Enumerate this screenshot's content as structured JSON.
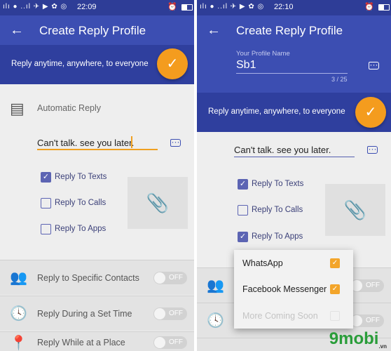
{
  "left": {
    "status": {
      "signal": "ılı ● ..ıl ✈ ▶ ✿ ◎",
      "time": "22:09"
    },
    "toolbar": {
      "title": "Create Reply Profile"
    },
    "banner": {
      "text": "Reply anytime, anywhere, to everyone"
    },
    "automatic_reply": {
      "label": "Automatic Reply"
    },
    "message": {
      "value": "Can't talk. see you later."
    },
    "checkboxes": [
      {
        "label": "Reply To Texts",
        "checked": true
      },
      {
        "label": "Reply To Calls",
        "checked": false
      },
      {
        "label": "Reply To Apps",
        "checked": false
      }
    ],
    "rows": [
      {
        "label": "Reply to Specific Contacts",
        "toggle": "OFF"
      },
      {
        "label": "Reply During a Set Time",
        "toggle": "OFF"
      },
      {
        "label": "Reply While at a Place",
        "toggle": "OFF"
      }
    ]
  },
  "right": {
    "status": {
      "signal": "ılı ● ..ıl ✈ ▶ ✿ ◎",
      "time": "22:10"
    },
    "toolbar": {
      "title": "Create Reply Profile",
      "profile_label": "Your Profile Name",
      "profile_value": "Sb1",
      "counter": "3 / 25"
    },
    "banner": {
      "text": "Reply anytime, anywhere, to everyone"
    },
    "message": {
      "value": "Can't talk. see you later."
    },
    "checkboxes": [
      {
        "label": "Reply To Texts",
        "checked": true
      },
      {
        "label": "Reply To Calls",
        "checked": false
      },
      {
        "label": "Reply To Apps",
        "checked": true
      }
    ],
    "rows": [
      {
        "toggle": "OFF"
      },
      {
        "toggle": "OFF"
      }
    ],
    "popup": [
      {
        "label": "WhatsApp",
        "checked": true
      },
      {
        "label": "Facebook Messenger",
        "checked": true
      },
      {
        "label": "More Coming Soon",
        "checked": false,
        "disabled": true
      }
    ]
  },
  "watermark": {
    "text": "9mobi",
    "sub": ".vn"
  },
  "colors": {
    "primary": "#3c4eb2",
    "banner": "#2f3f9e",
    "accent": "#f49c1e"
  }
}
